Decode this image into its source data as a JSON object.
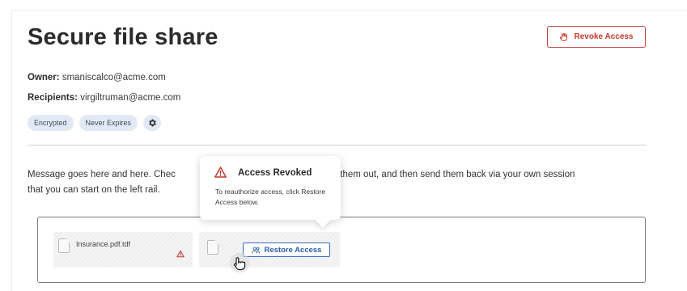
{
  "page": {
    "title": "Secure file share",
    "revoke_label": "Revoke Access",
    "owner_label": "Owner:",
    "owner_value": "smaniscalco@acme.com",
    "recipients_label": "Recipients:",
    "recipients_value": "virgiltruman@acme.com",
    "badges": [
      "Encrypted",
      "Never Expires"
    ],
    "message_left": "Message goes here and here. Chec",
    "message_right": ", fill them out, and then send them back via your own session",
    "message_line2": "that you can start on the left rail."
  },
  "files": [
    {
      "name": "Insurance.pdf.tdf"
    },
    {
      "name": ""
    }
  ],
  "restore_label": "Restore Access",
  "popover": {
    "title": "Access Revoked",
    "body": "To reauthorize access, click Restore Access below."
  },
  "colors": {
    "danger": "#c0392b",
    "primary": "#2a5db0",
    "badge_bg": "#e3e9f4"
  },
  "icons": {
    "revoke": "hand-stop-icon",
    "settings": "gear-icon",
    "warning": "warning-triangle-icon",
    "restore": "users-icon",
    "cursor": "hand-pointer-cursor-icon"
  }
}
